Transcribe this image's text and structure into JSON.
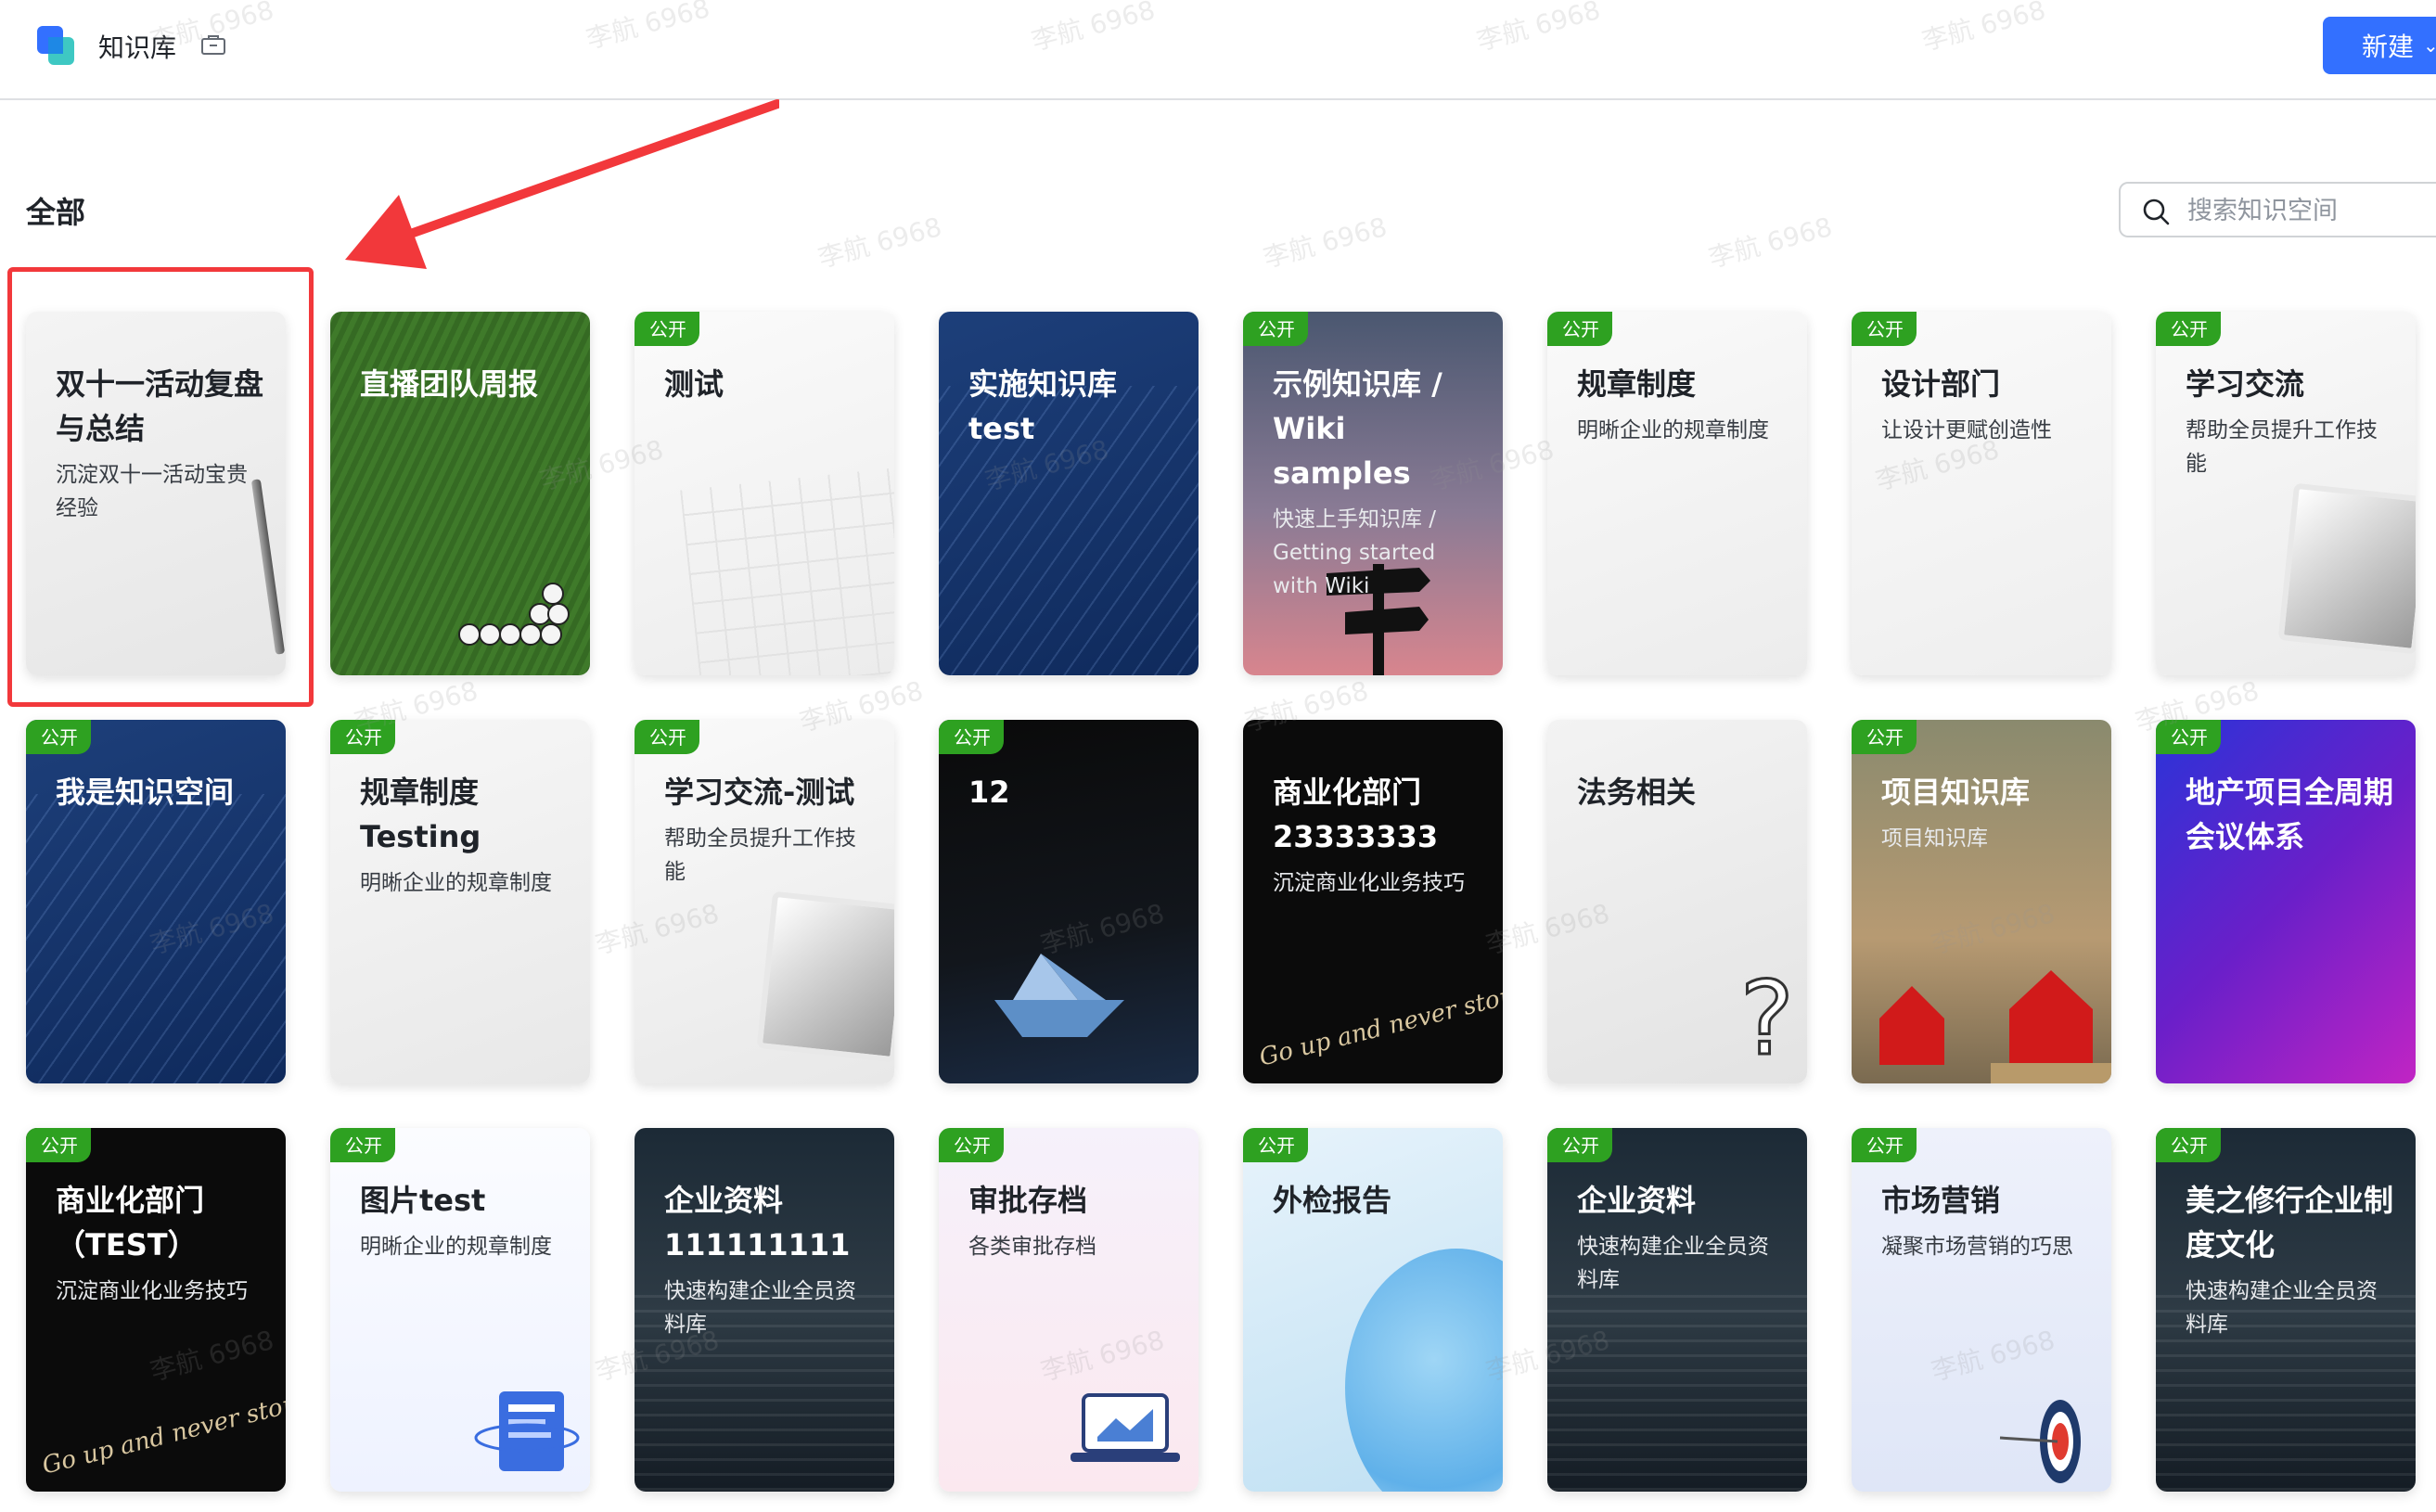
{
  "header": {
    "app_title": "知识库",
    "new_button": "新建"
  },
  "section_title": "全部",
  "search": {
    "placeholder": "搜索知识空间"
  },
  "badge_label": "公开",
  "watermark": "李航 6968",
  "cards": [
    {
      "title": "双十一活动复盘与总结",
      "desc": "沉淀双十一活动宝贵经验",
      "public": false,
      "highlighted": true
    },
    {
      "title": "直播团队周报",
      "desc": "",
      "public": false
    },
    {
      "title": "测试",
      "desc": "",
      "public": true
    },
    {
      "title": "实施知识库 test",
      "desc": "",
      "public": false
    },
    {
      "title": "示例知识库 / Wiki samples",
      "desc": "快速上手知识库 / Getting started with Wiki",
      "public": true
    },
    {
      "title": "规章制度",
      "desc": "明晰企业的规章制度",
      "public": true
    },
    {
      "title": "设计部门",
      "desc": "让设计更赋创造性",
      "public": true
    },
    {
      "title": "学习交流",
      "desc": "帮助全员提升工作技能",
      "public": true
    },
    {
      "title": "我是知识空间",
      "desc": "",
      "public": true
    },
    {
      "title": "规章制度 Testing",
      "desc": "明晰企业的规章制度",
      "public": true
    },
    {
      "title": "学习交流-测试",
      "desc": "帮助全员提升工作技能",
      "public": true
    },
    {
      "title": "12",
      "desc": "",
      "public": true
    },
    {
      "title": "商业化部门 23333333",
      "desc": "沉淀商业化业务技巧",
      "public": false,
      "slogan": "Go up and never stop"
    },
    {
      "title": "法务相关",
      "desc": "",
      "public": false
    },
    {
      "title": "项目知识库",
      "desc": "项目知识库",
      "public": true
    },
    {
      "title": "地产项目全周期会议体系",
      "desc": "",
      "public": true
    },
    {
      "title": "商业化部门（TEST）",
      "desc": "沉淀商业化业务技巧",
      "public": true,
      "slogan": "Go up and never stop"
    },
    {
      "title": "图片test",
      "desc": "明晰企业的规章制度",
      "public": true
    },
    {
      "title": "企业资料 111111111",
      "desc": "快速构建企业全员资料库",
      "public": false
    },
    {
      "title": "审批存档",
      "desc": "各类审批存档",
      "public": true
    },
    {
      "title": "外检报告",
      "desc": "",
      "public": true
    },
    {
      "title": "企业资料",
      "desc": "快速构建企业全员资料库",
      "public": true
    },
    {
      "title": "市场营销",
      "desc": "凝聚市场营销的巧思",
      "public": true
    },
    {
      "title": "美之修行企业制度文化",
      "desc": "快速构建企业全员资料库",
      "public": true
    }
  ]
}
